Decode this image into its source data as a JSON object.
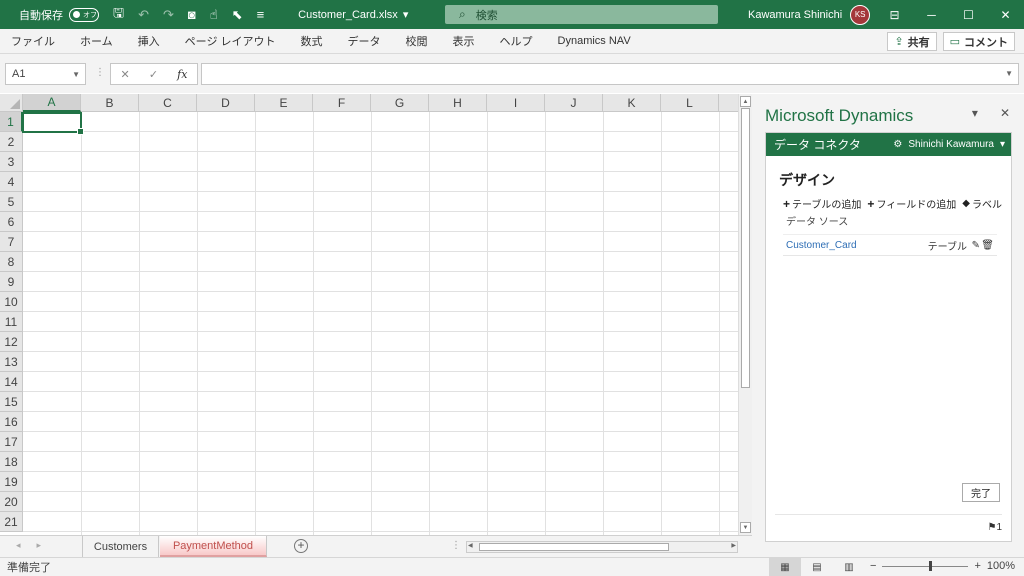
{
  "titlebar": {
    "autosave_label": "自動保存",
    "autosave_state": "オフ",
    "doc_name": "Customer_Card.xlsx",
    "doc_dropdown": "▾",
    "search_placeholder": "検索",
    "user_name": "Kawamura Shinichi",
    "user_initials": "KS"
  },
  "ribbon": {
    "tabs": [
      "ファイル",
      "ホーム",
      "挿入",
      "ページ レイアウト",
      "数式",
      "データ",
      "校閲",
      "表示",
      "ヘルプ",
      "Dynamics NAV"
    ],
    "share_label": "共有",
    "comment_label": "コメント"
  },
  "formula_bar": {
    "name_box": "A1",
    "formula": ""
  },
  "grid": {
    "columns": [
      "A",
      "B",
      "C",
      "D",
      "E",
      "F",
      "G",
      "H",
      "I",
      "J",
      "K",
      "L"
    ],
    "rows": [
      "1",
      "2",
      "3",
      "4",
      "5",
      "6",
      "7",
      "8",
      "9",
      "10",
      "11",
      "12",
      "13",
      "14",
      "15",
      "16",
      "17",
      "18",
      "19",
      "20",
      "21"
    ],
    "selected_cell": "A1"
  },
  "sheets": {
    "tabs": [
      "Customers",
      "PaymentMethod"
    ],
    "active": "PaymentMethod"
  },
  "pane": {
    "title": "Microsoft Dynamics",
    "addin": {
      "header": "データ コネクタ",
      "account": "Shinichi Kawamura",
      "section_title": "デザイン",
      "add_table": "テーブルの追加",
      "add_field": "フィールドの追加",
      "label": "ラベル",
      "datasource_label": "データ ソース",
      "datasource_name": "Customer_Card",
      "datasource_type": "テーブル",
      "done_label": "完了",
      "page_indicator": "1"
    }
  },
  "status": {
    "ready": "準備完了",
    "zoom": "100%"
  }
}
